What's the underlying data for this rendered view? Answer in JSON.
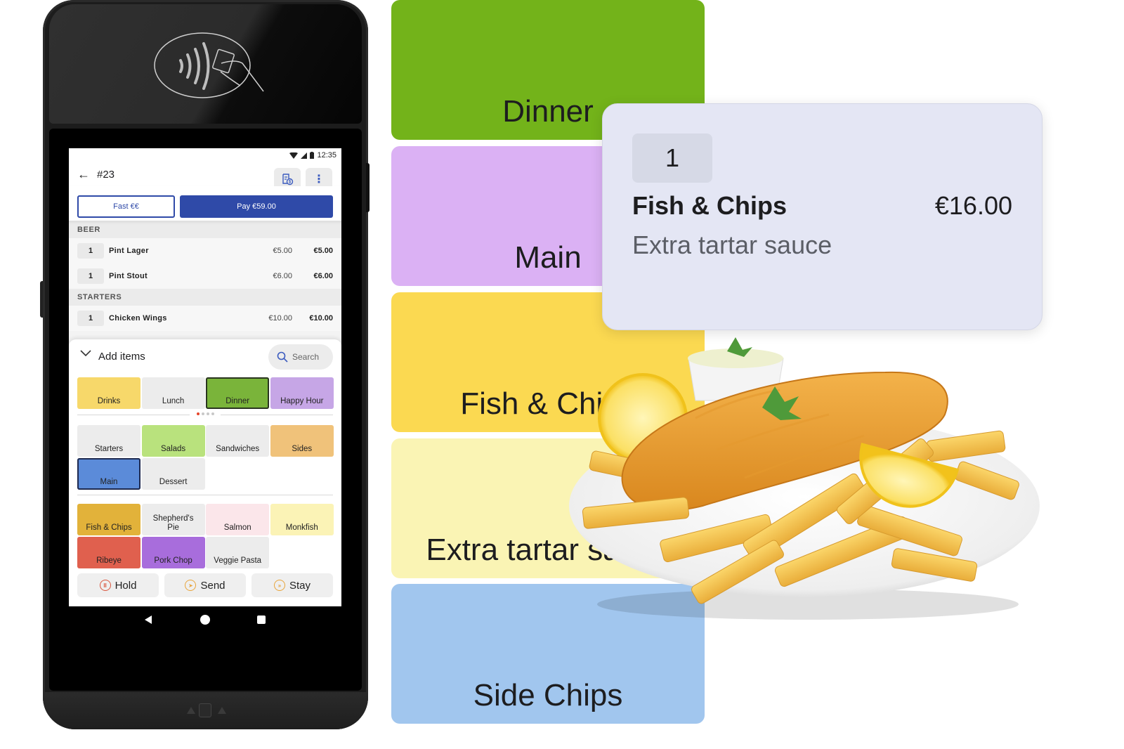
{
  "device": {
    "nfc_icon": "contactless-payment-icon",
    "status_bar": {
      "time": "12:35",
      "icons": [
        "wifi-icon",
        "signal-icon",
        "battery-icon"
      ]
    },
    "nav_bar": {
      "icons": [
        "nav-back-icon",
        "nav-home-icon",
        "nav-recent-icon"
      ]
    }
  },
  "app": {
    "header": {
      "back_icon": "←",
      "order_number": "#23",
      "receipt_icon": "receipt-dollar-icon",
      "more_icon": "⋮"
    },
    "buttons": {
      "fast": "Fast €€",
      "pay": "Pay €59.00"
    },
    "order": {
      "sections": [
        {
          "title": "BEER",
          "lines": [
            {
              "qty": "1",
              "name": "Pint Lager",
              "unit_price": "€5.00",
              "total": "€5.00"
            },
            {
              "qty": "1",
              "name": "Pint Stout",
              "unit_price": "€6.00",
              "total": "€6.00"
            }
          ]
        },
        {
          "title": "STARTERS",
          "lines": [
            {
              "qty": "1",
              "name": "Chicken Wings",
              "unit_price": "€10.00",
              "total": "€10.00"
            }
          ]
        }
      ]
    },
    "add_items": {
      "title": "Add items",
      "search_label": "Search",
      "menus": [
        {
          "label": "Drinks",
          "color": "#f7d86a"
        },
        {
          "label": "Lunch",
          "color": "#ececec"
        },
        {
          "label": "Dinner",
          "color": "#7ab43a",
          "selected": true
        },
        {
          "label": "Happy Hour",
          "color": "#c6a6e6"
        }
      ],
      "pager": {
        "pages": 4,
        "current": 1
      },
      "categories": [
        {
          "label": "Starters",
          "color": "#ececec"
        },
        {
          "label": "Salads",
          "color": "#b9e27d"
        },
        {
          "label": "Sandwiches",
          "color": "#ececec"
        },
        {
          "label": "Sides",
          "color": "#f0c27a"
        },
        {
          "label": "Main",
          "color": "#5b8bd9",
          "selected": true
        },
        {
          "label": "Dessert",
          "color": "#ececec"
        }
      ],
      "products": [
        {
          "label": "Fish & Chips",
          "color": "#e2b23a"
        },
        {
          "label": "Shepherd's Pie",
          "color": "#ececec"
        },
        {
          "label": "Salmon",
          "color": "#fbe6ea"
        },
        {
          "label": "Monkfish",
          "color": "#fbf3b6"
        },
        {
          "label": "Ribeye",
          "color": "#e0604e"
        },
        {
          "label": "Pork Chop",
          "color": "#a86ddc"
        },
        {
          "label": "Veggie Pasta",
          "color": "#ececec"
        }
      ]
    },
    "actions": [
      {
        "label": "Hold",
        "icon": "pause-icon",
        "glyph": "II",
        "color": "#d9573f"
      },
      {
        "label": "Send",
        "icon": "send-icon",
        "glyph": "➤",
        "color": "#e8a43a"
      },
      {
        "label": "Stay",
        "icon": "fast-forward-icon",
        "glyph": "»",
        "color": "#e8a43a"
      }
    ]
  },
  "showcase": {
    "tiles": [
      {
        "label": "Dinner",
        "color": "#73b31a"
      },
      {
        "label": "Main",
        "color": "#dbb1f4"
      },
      {
        "label": "Fish & Chips",
        "color": "#fbd951"
      },
      {
        "label": "Extra tartar sauce",
        "color": "#faf4b4"
      },
      {
        "label": "Side Chips",
        "color": "#a1c6ee"
      }
    ],
    "detail_card": {
      "qty": "1",
      "name": "Fish & Chips",
      "price": "€16.00",
      "modifier": "Extra tartar sauce"
    },
    "image": "fish-and-chips-plate"
  }
}
